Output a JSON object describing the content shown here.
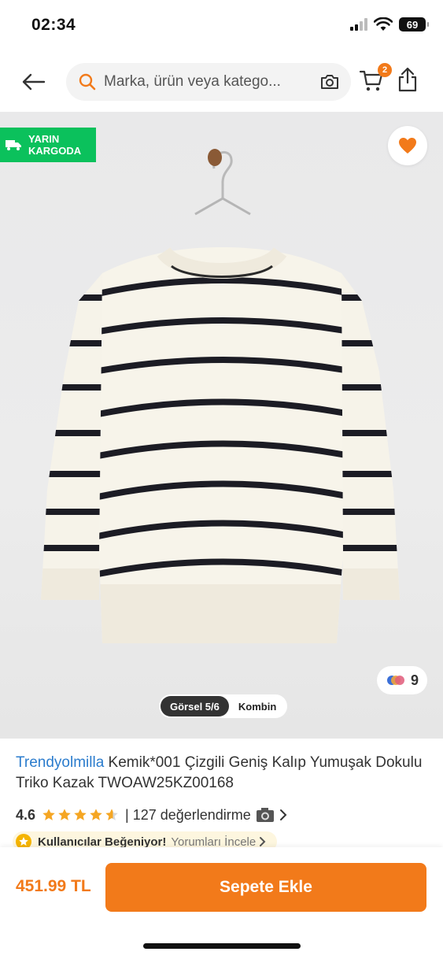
{
  "status_bar": {
    "time": "02:34",
    "battery": "69"
  },
  "header": {
    "search_placeholder": "Marka, ürün veya katego...",
    "cart_count": "2",
    "icons": [
      "back-arrow-icon",
      "search-icon",
      "camera-icon",
      "cart-icon",
      "share-icon"
    ]
  },
  "product_image": {
    "cargo_badge_line1": "YARIN",
    "cargo_badge_line2": "KARGODA",
    "color_count": "9",
    "tabs": [
      {
        "label": "Görsel 5/6",
        "active": true
      },
      {
        "label": "Kombin",
        "active": false
      }
    ]
  },
  "product": {
    "brand": "Trendyolmilla",
    "title": " Kemik*001 Çizgili Geniş Kalıp Yumuşak Dokulu Triko Kazak TWOAW25KZ00168",
    "rating": "4.6",
    "rating_value": 4.6,
    "review_text": "| 127 değerlendirme",
    "like_text": "Kullanıcılar Beğeniyor!",
    "like_link": "Yorumları İncele"
  },
  "bottom_bar": {
    "price": "451.99 TL",
    "add_to_cart": "Sepete Ekle"
  },
  "colors": {
    "accent": "#f27a1a",
    "brand_link": "#2b7ccd",
    "cargo_green": "#0bc15c",
    "star": "#f5a623"
  }
}
